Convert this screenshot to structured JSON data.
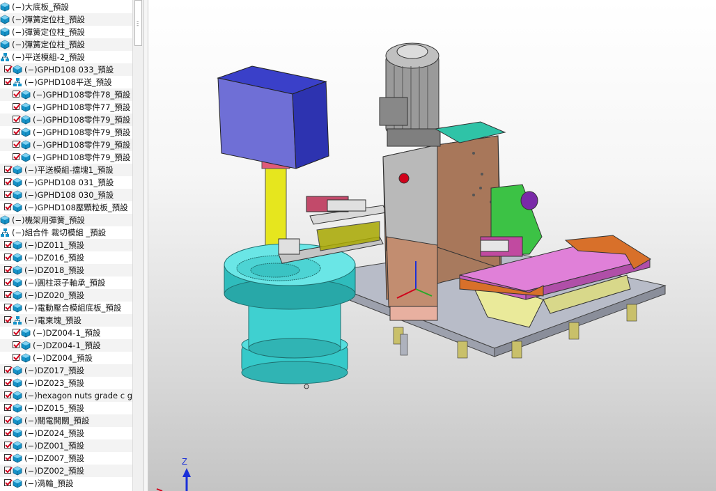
{
  "tree": {
    "items": [
      {
        "level": 0,
        "checked": false,
        "icon": "part-icon",
        "label": "(−)大底板_預設"
      },
      {
        "level": 0,
        "checked": false,
        "icon": "part-icon",
        "label": "(−)彈簧定位柱_預設"
      },
      {
        "level": 0,
        "checked": false,
        "icon": "part-icon",
        "label": "(−)彈簧定位柱_預設"
      },
      {
        "level": 0,
        "checked": false,
        "icon": "part-icon",
        "label": "(−)彈簧定位柱_預設"
      },
      {
        "level": 0,
        "checked": false,
        "icon": "assembly-icon",
        "label": "(−)平送模組-2_預設"
      },
      {
        "level": 1,
        "checked": true,
        "icon": "part-icon",
        "label": "(−)GPHD108 033_預設"
      },
      {
        "level": 1,
        "checked": true,
        "icon": "assembly-icon",
        "label": "(−)GPHD108平送_預設"
      },
      {
        "level": 2,
        "checked": true,
        "icon": "part-icon",
        "label": "(−)GPHD108零件78_預設"
      },
      {
        "level": 2,
        "checked": true,
        "icon": "part-icon",
        "label": "(−)GPHD108零件77_預設"
      },
      {
        "level": 2,
        "checked": true,
        "icon": "part-icon",
        "label": "(−)GPHD108零件79_預設"
      },
      {
        "level": 2,
        "checked": true,
        "icon": "part-icon",
        "label": "(−)GPHD108零件79_預設"
      },
      {
        "level": 2,
        "checked": true,
        "icon": "part-icon",
        "label": "(−)GPHD108零件79_預設"
      },
      {
        "level": 2,
        "checked": true,
        "icon": "part-icon",
        "label": "(−)GPHD108零件79_預設"
      },
      {
        "level": 1,
        "checked": true,
        "icon": "part-icon",
        "label": "(−)平送模組-擋塊1_預設"
      },
      {
        "level": 1,
        "checked": true,
        "icon": "part-icon",
        "label": "(−)GPHD108 031_預設"
      },
      {
        "level": 1,
        "checked": true,
        "icon": "part-icon",
        "label": "(−)GPHD108 030_預設"
      },
      {
        "level": 1,
        "checked": true,
        "icon": "part-icon",
        "label": "(−)GPHD108壓顆粒板_預設"
      },
      {
        "level": 0,
        "checked": false,
        "icon": "part-icon",
        "label": "(−)機架用彈簧_預設"
      },
      {
        "level": 0,
        "checked": false,
        "icon": "assembly-icon",
        "label": "(−)組合件 裁切模組 _預設"
      },
      {
        "level": 1,
        "checked": true,
        "icon": "part-icon",
        "label": "(−)DZ011_預設"
      },
      {
        "level": 1,
        "checked": true,
        "icon": "part-icon",
        "label": "(−)DZ016_預設"
      },
      {
        "level": 1,
        "checked": true,
        "icon": "part-icon",
        "label": "(−)DZ018_預設"
      },
      {
        "level": 1,
        "checked": true,
        "icon": "part-icon",
        "label": "(−)圓柱滾子軸承_預設"
      },
      {
        "level": 1,
        "checked": true,
        "icon": "part-icon",
        "label": "(−)DZ020_預設"
      },
      {
        "level": 1,
        "checked": true,
        "icon": "part-icon",
        "label": "(−)電動壓合模組底板_預設"
      },
      {
        "level": 1,
        "checked": true,
        "icon": "assembly-icon",
        "label": "(−)電柬塊_預設"
      },
      {
        "level": 2,
        "checked": true,
        "icon": "part-icon",
        "label": "(−)DZ004-1_預設"
      },
      {
        "level": 2,
        "checked": true,
        "icon": "part-icon",
        "label": "(−)DZ004-1_預設"
      },
      {
        "level": 2,
        "checked": true,
        "icon": "part-icon",
        "label": "(−)DZ004_預設"
      },
      {
        "level": 1,
        "checked": true,
        "icon": "part-icon",
        "label": "(−)DZ017_預設"
      },
      {
        "level": 1,
        "checked": true,
        "icon": "part-icon",
        "label": "(−)DZ023_預設"
      },
      {
        "level": 1,
        "checked": true,
        "icon": "part-icon",
        "label": "(−)hexagon nuts grade c gb_G"
      },
      {
        "level": 1,
        "checked": true,
        "icon": "part-icon",
        "label": "(−)DZ015_預設"
      },
      {
        "level": 1,
        "checked": true,
        "icon": "part-icon",
        "label": "(−)關電開關_預設"
      },
      {
        "level": 1,
        "checked": true,
        "icon": "part-icon",
        "label": "(−)DZ024_預設"
      },
      {
        "level": 1,
        "checked": true,
        "icon": "part-icon",
        "label": "(−)DZ001_預設"
      },
      {
        "level": 1,
        "checked": true,
        "icon": "part-icon",
        "label": "(−)DZ007_預設"
      },
      {
        "level": 1,
        "checked": true,
        "icon": "part-icon",
        "label": "(−)DZ002_預設"
      },
      {
        "level": 1,
        "checked": true,
        "icon": "part-icon",
        "label": "(−)渦輪_預設"
      }
    ]
  },
  "viewport": {
    "axis_label": "Z",
    "colors": {
      "accent_check": "#d0021b",
      "icon_blue": "#1593c9",
      "axis_blue": "#1a2fd8"
    }
  }
}
